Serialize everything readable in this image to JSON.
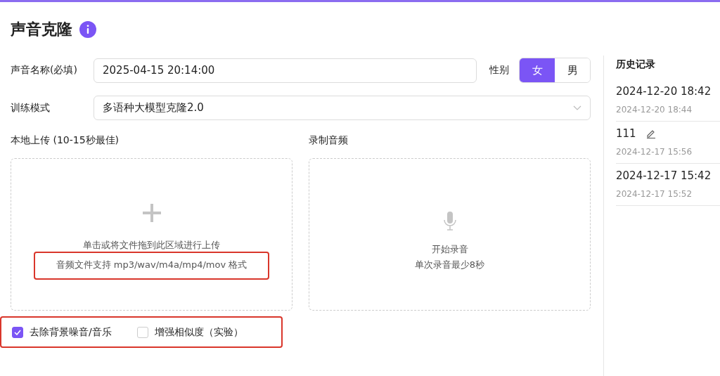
{
  "title": "声音克隆",
  "name_field": {
    "label": "声音名称(必填)",
    "value": "2025-04-15 20:14:00"
  },
  "gender": {
    "label": "性别",
    "options": [
      {
        "label": "女",
        "selected": true
      },
      {
        "label": "男",
        "selected": false
      }
    ]
  },
  "mode_field": {
    "label": "训练模式",
    "value": "多语种大模型克隆2.0"
  },
  "upload": {
    "label": "本地上传 (10-15秒最佳)",
    "hint": "单击或将文件拖到此区域进行上传",
    "formats": "音频文件支持 mp3/wav/m4a/mp4/mov 格式",
    "formats_highlighted": true
  },
  "record": {
    "label": "录制音频",
    "action": "开始录音",
    "hint": "单次录音最少8秒"
  },
  "options_highlighted": true,
  "options": [
    {
      "label": "去除背景噪音/音乐",
      "checked": true
    },
    {
      "label": "增强相似度（实验）",
      "checked": false
    }
  ],
  "history": {
    "title": "历史记录",
    "items": [
      {
        "name": "2024-12-20 18:42",
        "time": "2024-12-20 18:44",
        "editable": false
      },
      {
        "name": "111",
        "time": "2024-12-17 15:56",
        "editable": true
      },
      {
        "name": "2024-12-17 15:42",
        "time": "2024-12-17 15:52",
        "editable": false
      }
    ]
  }
}
